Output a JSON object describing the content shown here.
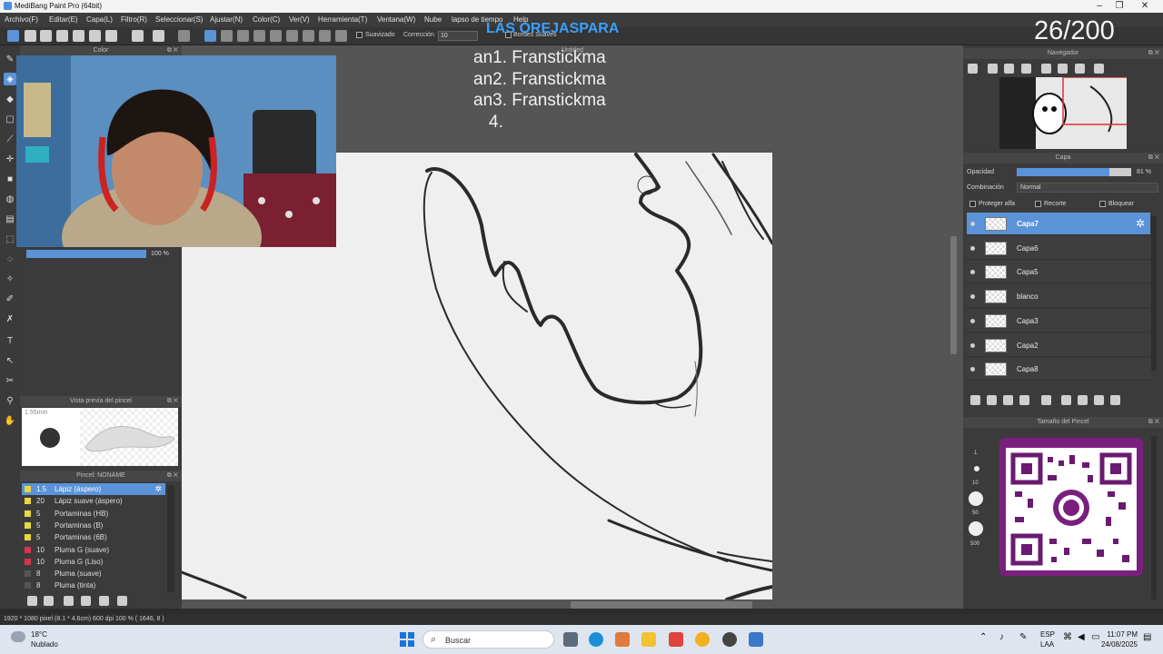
{
  "window": {
    "title": "MediBang Paint Pro (64bit)"
  },
  "menu": [
    "Archivo(F)",
    "Editar(E)",
    "Capa(L)",
    "Filtro(R)",
    "Seleccionar(S)",
    "Ajustar(N)",
    "Color(C)",
    "Ver(V)",
    "Herramienta(T)",
    "Ventana(W)",
    "Nube",
    "lapso de tiempo",
    "Help"
  ],
  "toolbar": {
    "smooth_label": "Suavizado",
    "correction_label": "Corrección",
    "correction_value": "10",
    "soft_edges_label": "Bordes Suaves"
  },
  "color_panel": {
    "title": "Color",
    "opacity_value": "100 %"
  },
  "canvas": {
    "title": "Untitled"
  },
  "overlay": {
    "title": "LAS OREJASPARA",
    "list": [
      "an1. Franstickma",
      "an2. Franstickma",
      "an3. Franstickma",
      "4."
    ],
    "counter": "26/200"
  },
  "brush_preview": {
    "title": "Vista previa del pincel",
    "size": "1.55mm"
  },
  "brush_panel": {
    "title": "Pincel: NONAME",
    "items": [
      {
        "size": "1.5",
        "name": "Lápiz (áspero)",
        "color": "#e8d83a",
        "selected": true
      },
      {
        "size": "20",
        "name": "Lápiz suave (áspero)",
        "color": "#e8d83a"
      },
      {
        "size": "5",
        "name": "Portaminas (HB)",
        "color": "#e8d83a"
      },
      {
        "size": "5",
        "name": "Portaminas (B)",
        "color": "#e8d83a"
      },
      {
        "size": "5",
        "name": "Portaminas (6B)",
        "color": "#e8d83a"
      },
      {
        "size": "10",
        "name": "Pluma G (suave)",
        "color": "#d9334a"
      },
      {
        "size": "10",
        "name": "Pluma G (Liso)",
        "color": "#d9334a"
      },
      {
        "size": "8",
        "name": "Pluma (suave)",
        "color": "#555555"
      },
      {
        "size": "8",
        "name": "Pluma (tinta)",
        "color": "#555555"
      }
    ]
  },
  "navigator": {
    "title": "Navegador"
  },
  "layers": {
    "title": "Capa",
    "opacity_label": "Opacidad",
    "opacity_value": "81 %",
    "opacity_fraction": 0.81,
    "blend_label": "Combinación",
    "blend_value": "Normal",
    "protect_alpha": "Proteger alfa",
    "clip": "Recorte",
    "lock": "Bloquear",
    "items": [
      {
        "name": "Capa7",
        "selected": true
      },
      {
        "name": "Capa6"
      },
      {
        "name": "Capa5"
      },
      {
        "name": "blanco"
      },
      {
        "name": "Capa3"
      },
      {
        "name": "Capa2"
      },
      {
        "name": "Capa8"
      }
    ]
  },
  "brush_size_panel": {
    "title": "Tamaño del Pincel",
    "sizes": [
      "1",
      "10",
      "50",
      "500"
    ]
  },
  "statusbar": {
    "info": "1920 * 1080 pixel  (8.1 * 4.6cm)  600 dpi  100 %  ( 1646, 8 )"
  },
  "taskbar": {
    "weather_temp": "18°C",
    "weather_desc": "Nublado",
    "search_placeholder": "Buscar",
    "lang": "ESP",
    "lang_sub": "LAA",
    "time": "11:07 PM",
    "date": "24/08/2025"
  },
  "colors": {
    "accent": "#5a93d8",
    "overlay_title": "#3aa0ff"
  }
}
